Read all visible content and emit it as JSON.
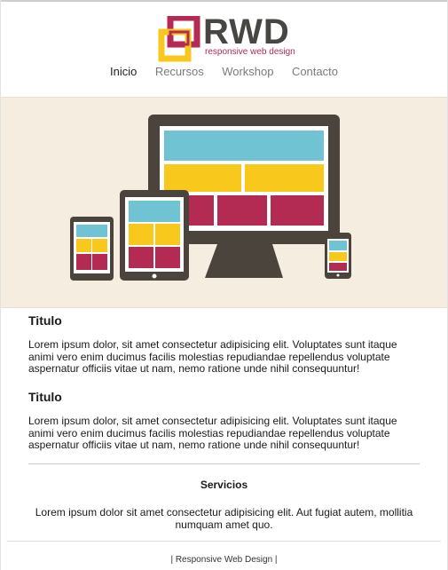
{
  "logo": {
    "text": "RWD",
    "subtitle": "responsive web design",
    "colors": {
      "outer": "#b32a52",
      "inner": "#f8c81c",
      "text": "#484642"
    }
  },
  "nav": {
    "items": [
      {
        "label": "Inicio",
        "active": true
      },
      {
        "label": "Recursos",
        "active": false
      },
      {
        "label": "Workshop",
        "active": false
      },
      {
        "label": "Contacto",
        "active": false
      }
    ]
  },
  "hero": {
    "illustration": "responsive-devices-illustration",
    "colors": {
      "background": "#f4ede0",
      "device": "#4a443d",
      "blue": "#6fc3d3",
      "yellow": "#f8c81c",
      "red": "#b32a52"
    }
  },
  "sections": [
    {
      "title": "Titulo",
      "text": "Lorem ipsum dolor, sit amet consectetur adipisicing elit. Voluptates sunt itaque animi vero enim ducimus facilis molestias repudiandae repellendus voluptate aspernatur officiis vitae ut nam, nemo ratione unde nihil consequuntur!"
    },
    {
      "title": "Titulo",
      "text": "Lorem ipsum dolor, sit amet consectetur adipisicing elit. Voluptates sunt itaque animi vero enim ducimus facilis molestias repudiandae repellendus voluptate aspernatur officiis vitae ut nam, nemo ratione unde nihil consequuntur!"
    }
  ],
  "services": {
    "title": "Servicios",
    "text": "Lorem ipsum dolor sit amet consectetur adipisicing elit. Aut fugiat autem, mollitia numquam amet quo."
  },
  "footer": {
    "text": "| Responsive Web Design |"
  }
}
